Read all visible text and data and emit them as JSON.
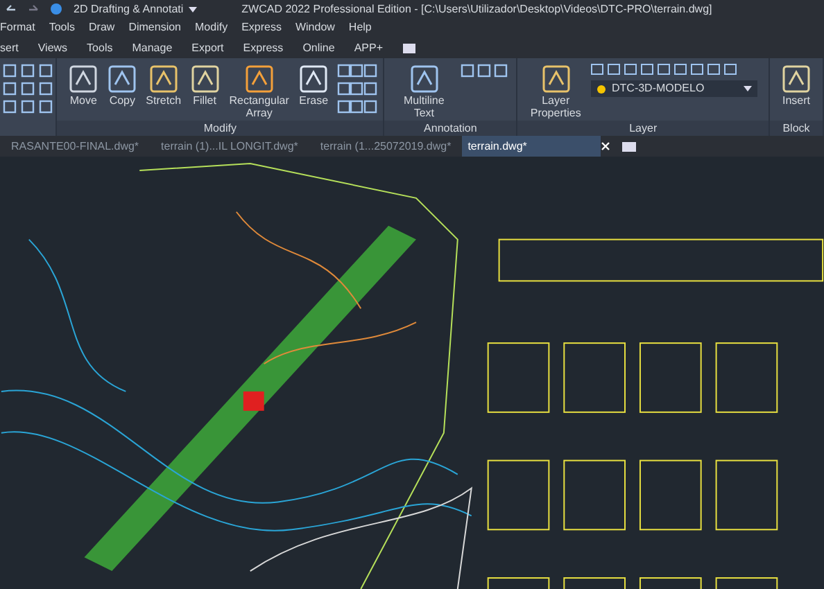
{
  "title_bar": {
    "workspace": "2D Drafting & Annotati",
    "title": "ZWCAD 2022 Professional Edition - [C:\\Users\\Utilizador\\Desktop\\Videos\\DTC-PRO\\terrain.dwg]"
  },
  "menu": [
    "Format",
    "Tools",
    "Draw",
    "Dimension",
    "Modify",
    "Express",
    "Window",
    "Help"
  ],
  "ribbon_tabs": [
    "sert",
    "Views",
    "Tools",
    "Manage",
    "Export",
    "Express",
    "Online",
    "APP+"
  ],
  "panels": [
    {
      "title": "Modify",
      "buttons": [
        "Move",
        "Copy",
        "Stretch",
        "Fillet",
        "Rectangular Array",
        "Erase"
      ]
    },
    {
      "title": "Annotation",
      "buttons": [
        "Multiline Text"
      ]
    },
    {
      "title": "Layer",
      "buttons": [
        "Layer Properties"
      ],
      "layer": "DTC-3D-MODELO"
    },
    {
      "title": "Block",
      "buttons": [
        "Insert"
      ]
    }
  ],
  "file_tabs": [
    {
      "label": "RASANTE00-FINAL.dwg*",
      "selected": false
    },
    {
      "label": "terrain (1)...IL LONGIT.dwg*",
      "selected": false
    },
    {
      "label": "terrain (1...25072019.dwg*",
      "selected": false
    },
    {
      "label": "terrain.dwg*",
      "selected": true
    }
  ]
}
